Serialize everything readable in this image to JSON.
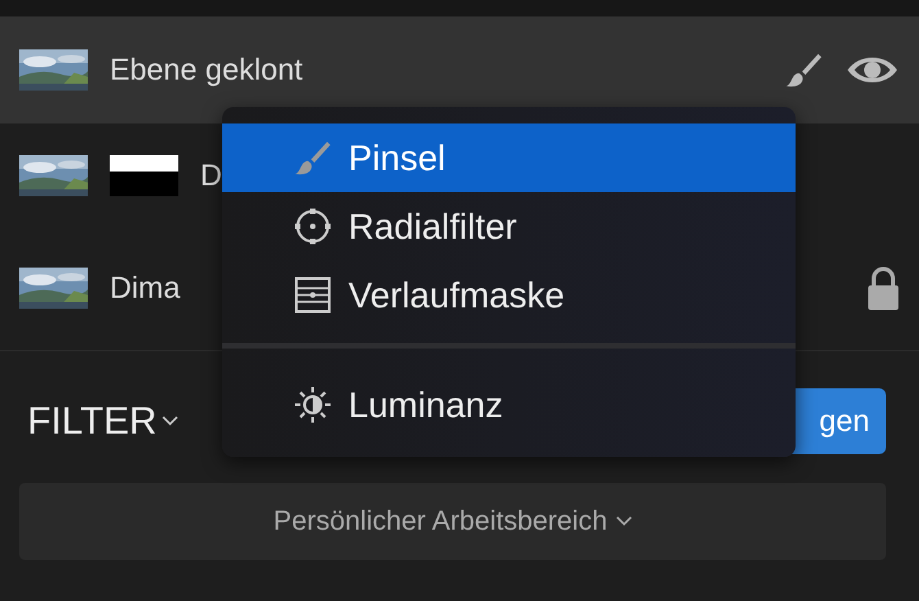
{
  "layers": [
    {
      "name": "Ebene geklont",
      "kind": "brush",
      "selected": true
    },
    {
      "name": "D",
      "kind": "mask",
      "selected": false
    },
    {
      "name": "Dima",
      "kind": "locked",
      "selected": false
    }
  ],
  "filter": {
    "label": "FILTER",
    "button": "gen"
  },
  "workspace": {
    "label": "Persönlicher Arbeitsbereich"
  },
  "menu": {
    "items": [
      {
        "label": "Pinsel",
        "kind": "brush",
        "selected": true
      },
      {
        "label": "Radialfilter",
        "kind": "radial",
        "selected": false
      },
      {
        "label": "Verlaufmaske",
        "kind": "gradient",
        "selected": false
      },
      {
        "kind": "separator"
      },
      {
        "label": "Luminanz",
        "kind": "luminance",
        "selected": false
      }
    ]
  }
}
